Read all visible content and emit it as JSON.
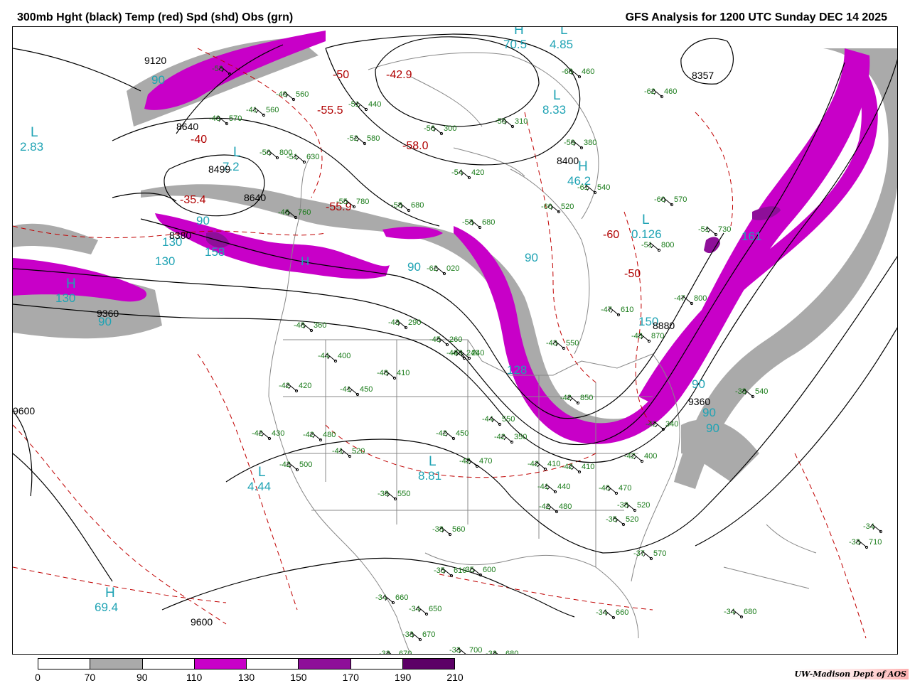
{
  "header": {
    "left_title": "300mb Hght (black) Temp (red) Spd (shd) Obs (grn)",
    "right_title": "GFS Analysis for 1200 UTC Sunday  DEC 14 2025"
  },
  "legend": {
    "ticks": [
      "0",
      "70",
      "90",
      "110",
      "130",
      "150",
      "170",
      "190",
      "210"
    ],
    "colors": [
      "#ffffff",
      "#aaaaaa",
      "#ffffff",
      "#c800c8",
      "#ffffff",
      "#8e0f99",
      "#ffffff",
      "#5c0066"
    ]
  },
  "credit": "UW-Madison  Dept of AOS",
  "map": {
    "speed_labels": [
      "90",
      "130",
      "90",
      "130",
      "158",
      "90",
      "H",
      "90",
      "90",
      "128",
      "90",
      "90",
      "90",
      "150",
      "161"
    ],
    "pressure_centers": [
      {
        "letter": "L",
        "value": "2.83"
      },
      {
        "letter": "H",
        "value": "130"
      },
      {
        "letter": "H",
        "value": "69.4"
      },
      {
        "letter": "L",
        "value": "4.44"
      },
      {
        "letter": "L",
        "value": "8.81"
      },
      {
        "letter": "L",
        "value": "4.85"
      },
      {
        "letter": "L",
        "value": "8.33"
      },
      {
        "letter": "H",
        "value": "46.2"
      },
      {
        "letter": "L",
        "value": "0.126"
      },
      {
        "letter": "L",
        "value": "7.2"
      },
      {
        "letter": "H",
        "value": "70.5"
      }
    ],
    "height_labels": [
      "9120",
      "8640",
      "8499",
      "8640",
      "8380",
      "9360",
      "9600",
      "8400",
      "8357",
      "9360",
      "9600",
      "9360",
      "8880"
    ],
    "temp_labels": [
      "-40",
      "-35.4",
      "-42.9",
      "-50",
      "-55.5",
      "-58.0",
      "-55.9",
      "-60",
      "-50"
    ],
    "obs": [
      {
        "t": "-53",
        "v": ""
      },
      {
        "t": "-49",
        "v": "560"
      },
      {
        "t": "-41",
        "v": "560"
      },
      {
        "t": "-40",
        "v": "570"
      },
      {
        "t": "-51",
        "v": "440"
      },
      {
        "t": "-52",
        "v": "580"
      },
      {
        "t": "-50",
        "v": "800"
      },
      {
        "t": "-51",
        "v": "630"
      },
      {
        "t": "-54",
        "v": "420"
      },
      {
        "t": "-56",
        "v": "300"
      },
      {
        "t": "-59",
        "v": "310"
      },
      {
        "t": "-59",
        "v": "380"
      },
      {
        "t": "-68",
        "v": "460"
      },
      {
        "t": "-62",
        "v": "460"
      },
      {
        "t": "-61",
        "v": "540"
      },
      {
        "t": "-60",
        "v": "520"
      },
      {
        "t": "-60",
        "v": "570"
      },
      {
        "t": "-51",
        "v": "800"
      },
      {
        "t": "-46",
        "v": "760"
      },
      {
        "t": "-55",
        "v": "780"
      },
      {
        "t": "-58",
        "v": "680"
      },
      {
        "t": "-53",
        "v": "680"
      },
      {
        "t": "-62",
        "v": "020"
      },
      {
        "t": "-48",
        "v": "240"
      },
      {
        "t": "-48",
        "v": "360"
      },
      {
        "t": "-44",
        "v": "400"
      },
      {
        "t": "-42",
        "v": "420"
      },
      {
        "t": "-42",
        "v": "430"
      },
      {
        "t": "-42",
        "v": "480"
      },
      {
        "t": "-41",
        "v": "520"
      },
      {
        "t": "-42",
        "v": "500"
      },
      {
        "t": "-41",
        "v": "450"
      },
      {
        "t": "-48",
        "v": "410"
      },
      {
        "t": "-43",
        "v": "290"
      },
      {
        "t": "-45",
        "v": "260"
      },
      {
        "t": "-46",
        "v": "240"
      },
      {
        "t": "-42",
        "v": "450"
      },
      {
        "t": "-42",
        "v": "470"
      },
      {
        "t": "-39",
        "v": "550"
      },
      {
        "t": "-38",
        "v": "560"
      },
      {
        "t": "-42",
        "v": "850"
      },
      {
        "t": "-42",
        "v": "410"
      },
      {
        "t": "-41",
        "v": "440"
      },
      {
        "t": "-42",
        "v": "480"
      },
      {
        "t": "-42",
        "v": "410"
      },
      {
        "t": "-40",
        "v": "470"
      },
      {
        "t": "-38",
        "v": "520"
      },
      {
        "t": "-35",
        "v": "520"
      },
      {
        "t": "-37",
        "v": "570"
      },
      {
        "t": "-35",
        "v": "610"
      },
      {
        "t": "-35",
        "v": "600"
      },
      {
        "t": "-34",
        "v": "660"
      },
      {
        "t": "-34",
        "v": "650"
      },
      {
        "t": "-33",
        "v": "670"
      },
      {
        "t": "-33",
        "v": "670"
      },
      {
        "t": "-33",
        "v": "700"
      },
      {
        "t": "-33",
        "v": "680"
      },
      {
        "t": "-34",
        "v": "660"
      },
      {
        "t": "-34",
        "v": "680"
      },
      {
        "t": "-38",
        "v": "540"
      },
      {
        "t": "-33",
        "v": "710"
      },
      {
        "t": "-34",
        "v": ""
      },
      {
        "t": "-47",
        "v": "610"
      },
      {
        "t": "-48",
        "v": "870"
      },
      {
        "t": "-47",
        "v": "800"
      },
      {
        "t": "-51",
        "v": "730"
      },
      {
        "t": "-42",
        "v": "340"
      },
      {
        "t": "-42",
        "v": "400"
      },
      {
        "t": "-42",
        "v": "350"
      },
      {
        "t": "-44",
        "v": "550"
      },
      {
        "t": "-43",
        "v": "550"
      }
    ]
  }
}
